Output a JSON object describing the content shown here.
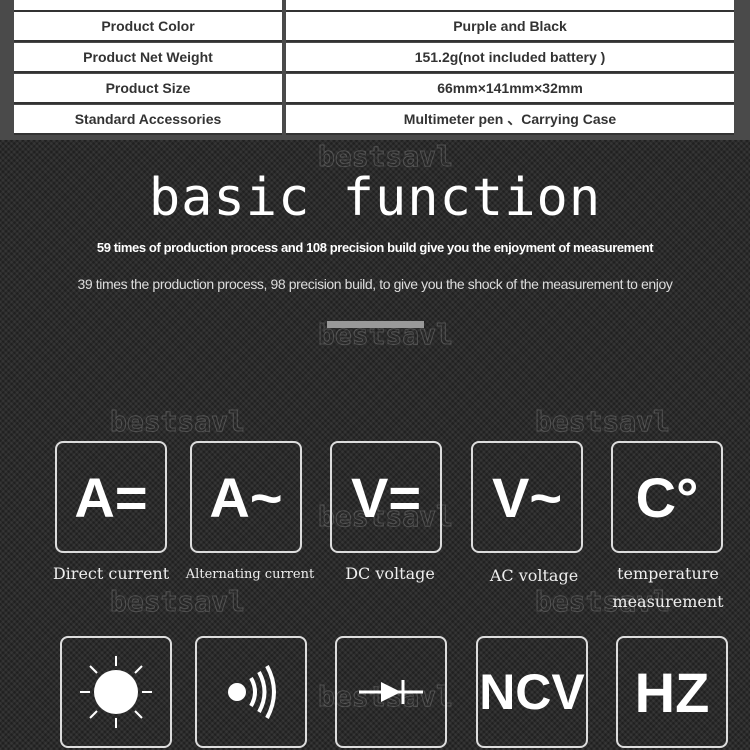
{
  "specs": [
    {
      "label": "Product Color",
      "value": "Purple and Black"
    },
    {
      "label": "Product Net Weight",
      "value": "151.2g(not included battery )"
    },
    {
      "label": "Product Size",
      "value": "66mm×141mm×32mm"
    },
    {
      "label": "Standard Accessories",
      "value": "Multimeter pen 、Carrying Case"
    }
  ],
  "watermark": "bestsavl",
  "section": {
    "title": "basic function",
    "subtitle": "59 times of  production process and 108 precision build give you the enjoyment of measurement",
    "description": "39 times the production process, 98 precision build, to give you the shock of the measurement to enjoy"
  },
  "functions": [
    {
      "symbol": "A=",
      "label": "Direct current"
    },
    {
      "symbol": "A~",
      "label": "Alternating current"
    },
    {
      "symbol": "V=",
      "label": "DC voltage"
    },
    {
      "symbol": "V~",
      "label": "AC voltage"
    },
    {
      "symbol": "C°",
      "label": "temperature measurement"
    }
  ],
  "functions2": [
    {
      "icon": "backlight-icon"
    },
    {
      "icon": "continuity-buzzer-icon"
    },
    {
      "icon": "diode-icon"
    },
    {
      "symbol": "NCV"
    },
    {
      "symbol": "HZ"
    }
  ]
}
